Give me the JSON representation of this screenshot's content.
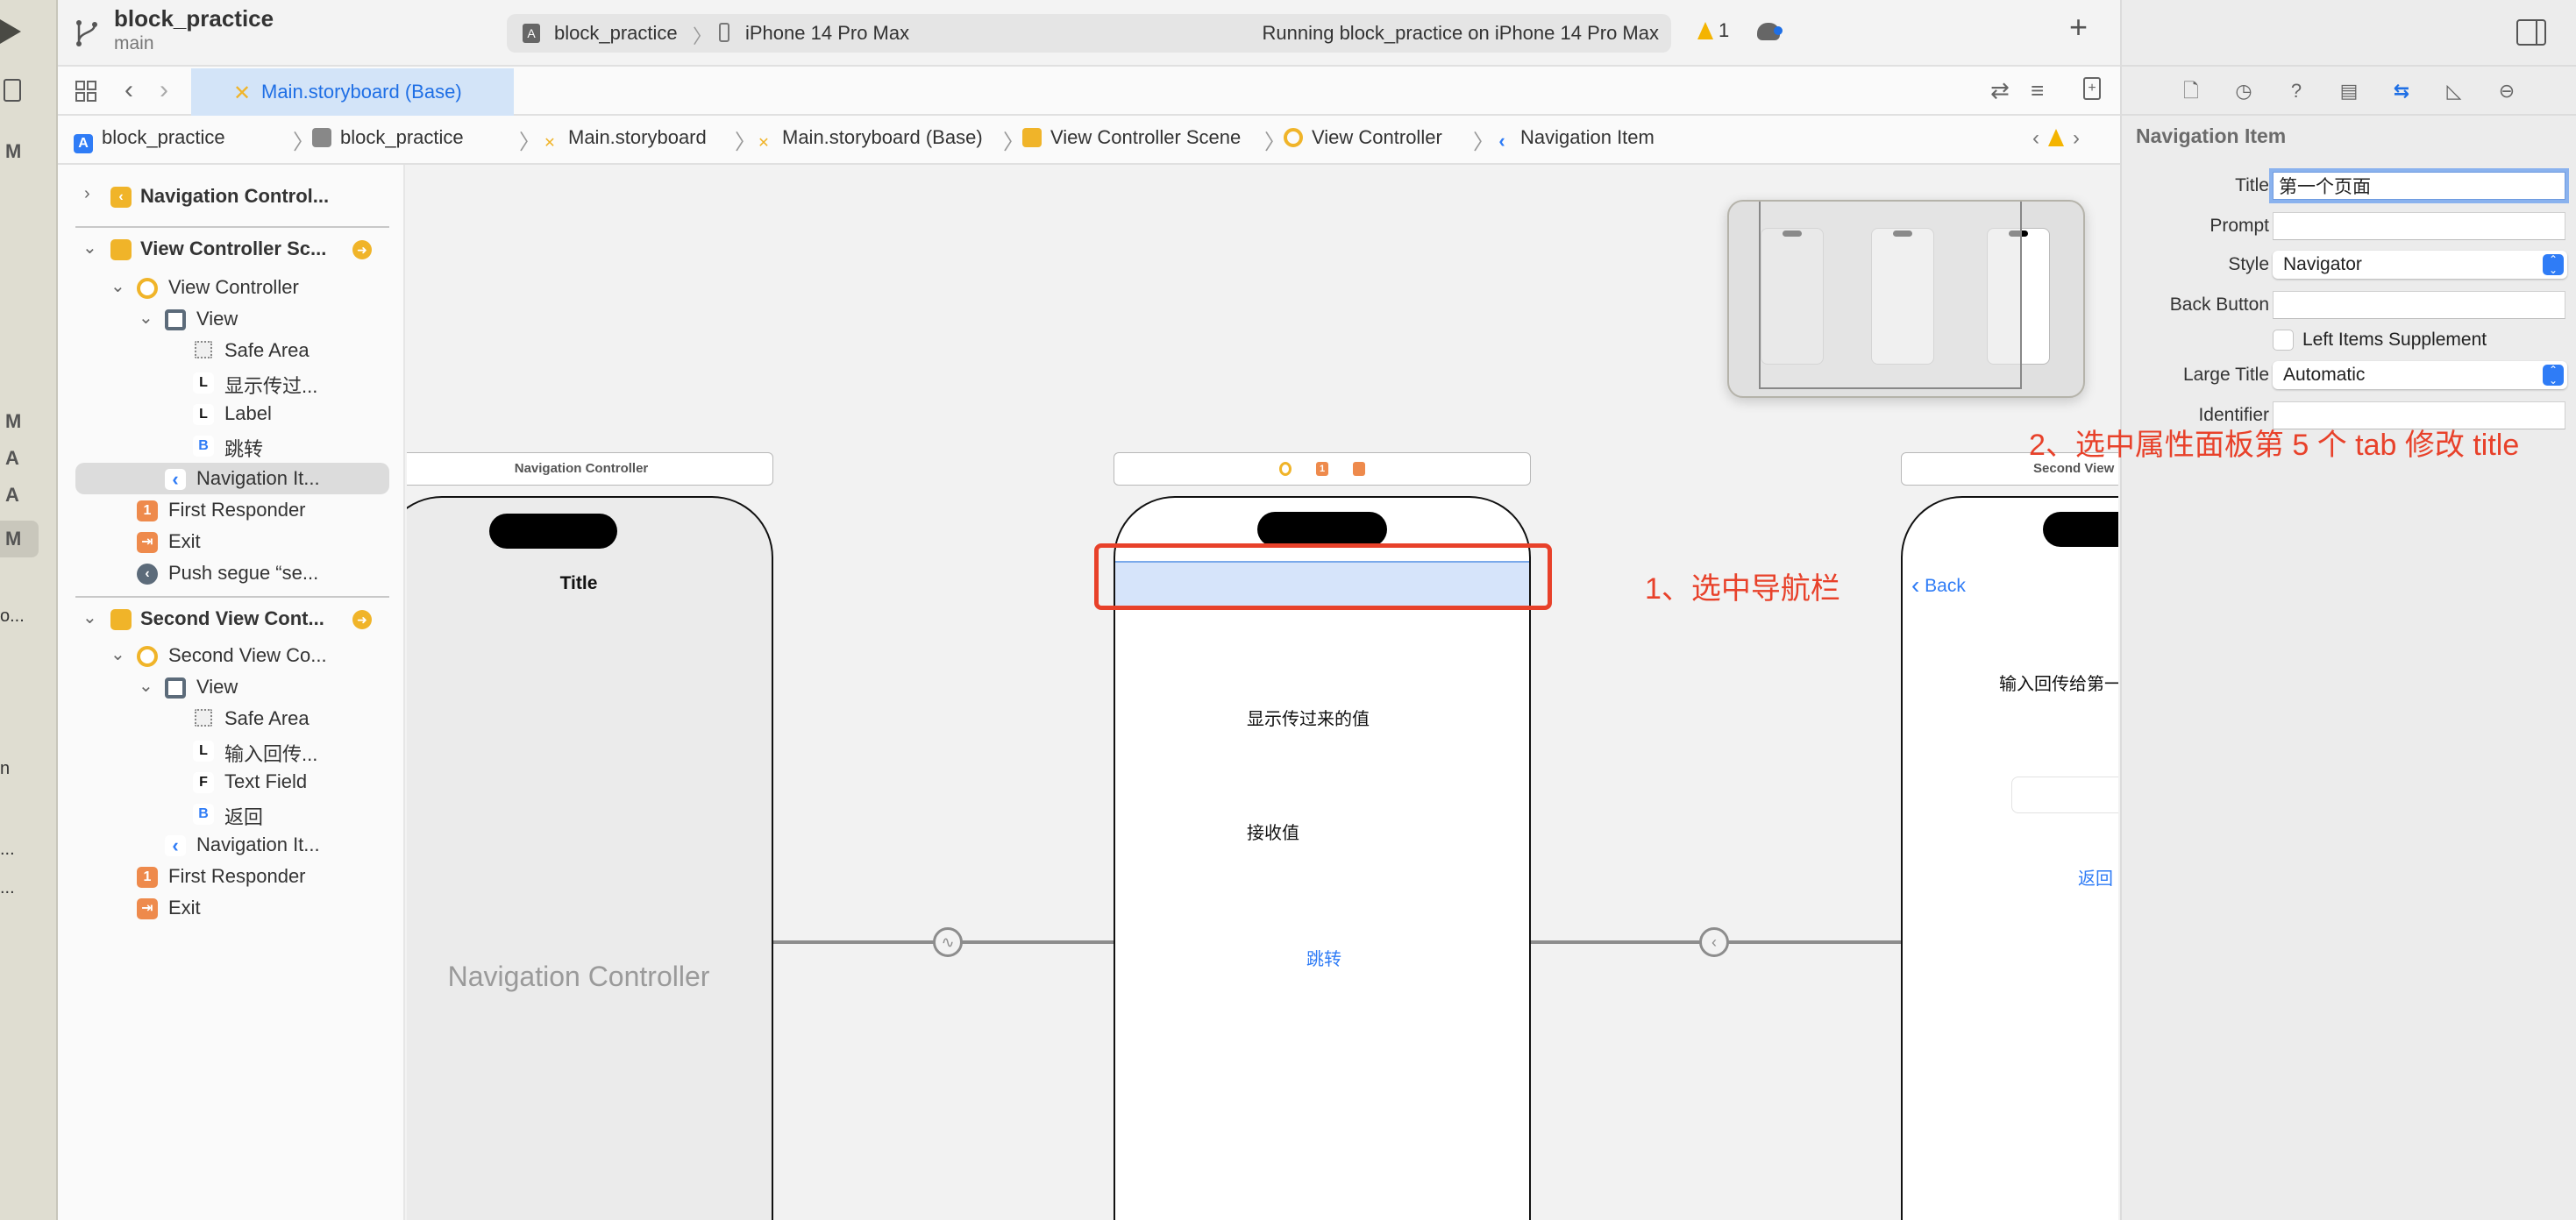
{
  "toolbar": {
    "project_name": "block_practice",
    "branch": "main",
    "scheme": "block_practice",
    "device": "iPhone 14 Pro Max",
    "status": "Running block_practice on iPhone 14 Pro Max",
    "warning_count": "1",
    "add_label": "+"
  },
  "left_strip": {
    "letters": [
      "M",
      "M",
      "A",
      "A",
      "M"
    ],
    "truncated": [
      "o...",
      "n",
      "...",
      "..."
    ]
  },
  "tabbar": {
    "active_tab": "Main.storyboard (Base)"
  },
  "jumpbar": {
    "crumbs": [
      "block_practice",
      "block_practice",
      "Main.storyboard",
      "Main.storyboard (Base)",
      "View Controller Scene",
      "View Controller",
      "Navigation Item"
    ]
  },
  "navigator": {
    "rows": [
      {
        "label": "Navigation Control..."
      },
      {
        "label": "View Controller Sc..."
      },
      {
        "label": "View Controller"
      },
      {
        "label": "View"
      },
      {
        "label": "Safe Area"
      },
      {
        "label": "显示传过..."
      },
      {
        "label": "Label"
      },
      {
        "label": "跳转"
      },
      {
        "label": "Navigation It..."
      },
      {
        "label": "First Responder"
      },
      {
        "label": "Exit"
      },
      {
        "label": "Push segue “se..."
      },
      {
        "label": "Second View Cont..."
      },
      {
        "label": "Second View Co..."
      },
      {
        "label": "View"
      },
      {
        "label": "Safe Area"
      },
      {
        "label": "输入回传..."
      },
      {
        "label": "Text Field"
      },
      {
        "label": "返回"
      },
      {
        "label": "Navigation It..."
      },
      {
        "label": "First Responder"
      },
      {
        "label": "Exit"
      }
    ],
    "icon_letters": {
      "L": "L",
      "B": "B",
      "F": "F",
      "one": "1"
    }
  },
  "canvas": {
    "nav_controller": {
      "scene_title": "Navigation Controller",
      "nav_title": "Title",
      "placeholder": "Navigation Controller"
    },
    "first_vc": {
      "label1": "显示传过来的值",
      "label2": "接收值",
      "button": "跳转",
      "dock_icons": [
        "view-controller",
        "first-responder",
        "exit"
      ]
    },
    "second_vc": {
      "scene_title": "Second View C",
      "back": "Back",
      "label": "输入回传给第一",
      "button": "返回"
    },
    "annotations": {
      "step1": "1、选中导航栏",
      "step2": "2、选中属性面板第 5 个 tab 修改 title"
    },
    "annotation_color": "#e8412a"
  },
  "inspector": {
    "tabs": [
      "file",
      "history",
      "help",
      "identity",
      "attributes",
      "size",
      "connections"
    ],
    "active_tab_index": 4,
    "section_title": "Navigation Item",
    "fields": {
      "title_label": "Title",
      "title_value": "第一个页面",
      "prompt_label": "Prompt",
      "prompt_value": "",
      "style_label": "Style",
      "style_value": "Navigator",
      "back_button_label": "Back Button",
      "back_button_value": "",
      "left_items_label": "Left Items Supplement",
      "left_items_checked": false,
      "large_title_label": "Large Title",
      "large_title_value": "Automatic",
      "identifier_label": "Identifier",
      "identifier_value": ""
    }
  },
  "colors": {
    "accent": "#1f6fe5",
    "warning": "#f4b400",
    "scene_icon": "#f0b429",
    "responder": "#ee8a4c",
    "selection": "#d3e4f8"
  }
}
